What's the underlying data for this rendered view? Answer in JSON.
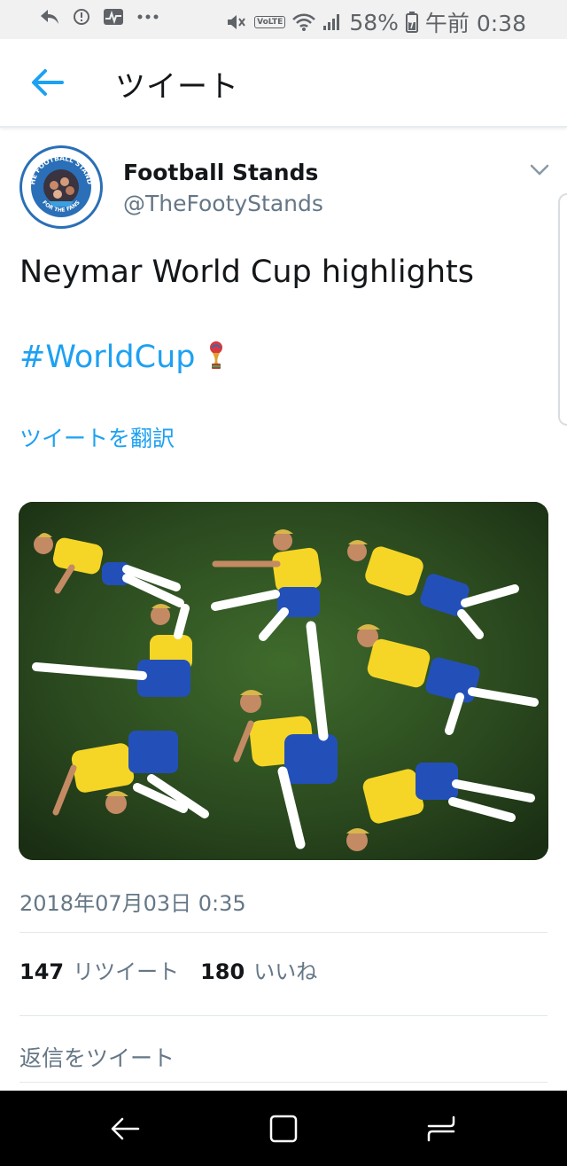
{
  "status_bar": {
    "battery": "58%",
    "time": "午前 0:38",
    "volte": "VoLTE",
    "left_icons": [
      "reply-arrow-icon",
      "info-icon",
      "activity-icon",
      "more-dots-icon"
    ],
    "right_icons": [
      "mute-icon",
      "volte-icon",
      "wifi-icon",
      "signal-icon",
      "battery-icon"
    ]
  },
  "header": {
    "title": "ツイート",
    "back_icon": "back-arrow-icon",
    "accent_color": "#1da1f2"
  },
  "tweet": {
    "display_name": "Football Stands",
    "handle": "@TheFootyStands",
    "avatar_icon": "football-stands-logo",
    "avatar_text_top": "THE FOOTBALL STANDS",
    "avatar_text_bottom": "FOR THE FANS",
    "text": "Neymar World Cup highlights",
    "hashtag": "#WorldCup",
    "hashtag_emoji_icon": "world-cup-trophy-icon",
    "translate_label": "ツイートを翻訳",
    "timestamp": "2018年07月03日 0:35",
    "retweet_count": "147",
    "retweet_label": "リツイート",
    "like_count": "180",
    "like_label": "いいね",
    "reply_placeholder": "返信をツイート"
  },
  "nav_bar": {
    "icons": [
      "nav-back-icon",
      "nav-home-icon",
      "nav-recents-icon"
    ]
  },
  "colors": {
    "link": "#1da1f2",
    "secondary_text": "#657786",
    "primary_text": "#14171a",
    "status_bar_bg": "#f1f1f1",
    "nav_bar_bg": "#000000"
  }
}
